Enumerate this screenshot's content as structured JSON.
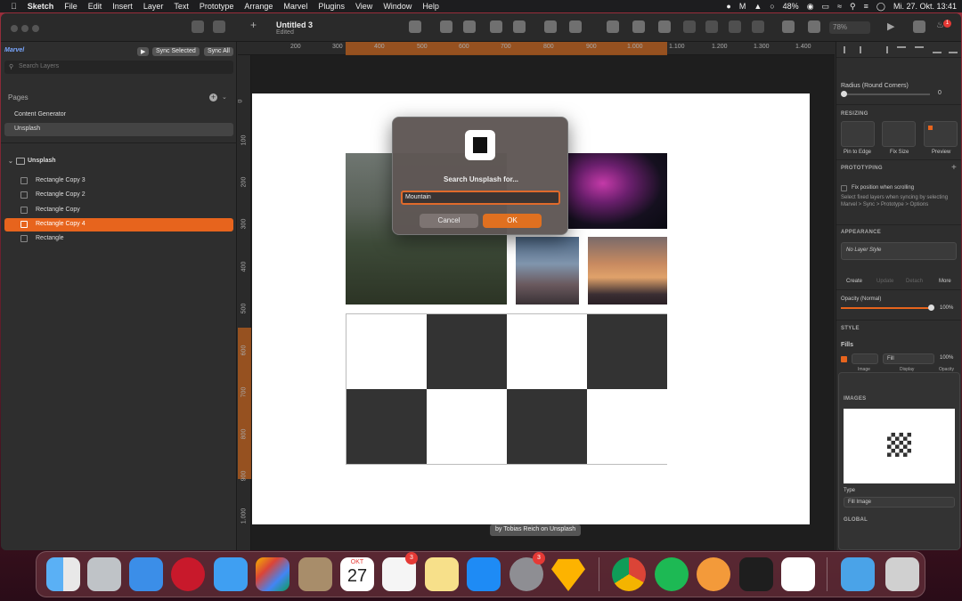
{
  "menubar": {
    "app": "Sketch",
    "items": [
      "File",
      "Edit",
      "Insert",
      "Layer",
      "Text",
      "Prototype",
      "Arrange",
      "Marvel",
      "Plugins",
      "View",
      "Window",
      "Help"
    ],
    "battery": "48%",
    "clock": "Mi. 27. Okt.  13:41",
    "notification_badge": "1"
  },
  "toolbar": {
    "doc_title": "Untitled 3",
    "doc_status": "Edited",
    "zoom": "78%"
  },
  "sidebar": {
    "marvel_logo": "Marvel",
    "sync_selected": "Sync Selected",
    "sync_all": "Sync All",
    "search_placeholder": "Search Layers",
    "pages_label": "Pages",
    "pages": [
      "Content Generator",
      "Unsplash"
    ],
    "artboard": "Unsplash",
    "layers": [
      "Rectangle Copy 3",
      "Rectangle Copy 2",
      "Rectangle Copy",
      "Rectangle Copy 4",
      "Rectangle"
    ]
  },
  "rulers": {
    "top": [
      "200",
      "300",
      "400",
      "500",
      "600",
      "700",
      "800",
      "900",
      "1.000",
      "1.100",
      "1.200",
      "1.300",
      "1.400"
    ],
    "left": [
      "0",
      "100",
      "200",
      "300",
      "400",
      "500",
      "600",
      "700",
      "800",
      "900",
      "1.000"
    ]
  },
  "dialog": {
    "title": "Search Unsplash for...",
    "input_value": "Mountain",
    "cancel": "Cancel",
    "ok": "OK"
  },
  "attribution": "by Tobias Reich on Unsplash",
  "inspector": {
    "radius_label": "Radius (Round Corners)",
    "radius_value": "0",
    "resizing": "RESIZING",
    "pin_to_edge": "Pin to Edge",
    "fix_size": "Fix Size",
    "preview": "Preview",
    "prototyping": "PROTOTYPING",
    "fix_position": "Fix position when scrolling",
    "fix_position_help": "Select fixed layers when syncing by selecting Marvel > Sync > Prototype > Options",
    "appearance": "APPEARANCE",
    "layer_style": "No Layer Style",
    "create": "Create",
    "update": "Update",
    "detach": "Detach",
    "more": "More",
    "opacity_label": "Opacity (Normal)",
    "opacity_value": "100%",
    "style": "STYLE",
    "fills": "Fills",
    "fill_type": "Fill",
    "fill_opacity": "100%",
    "image_label": "Image",
    "display_label": "Display",
    "opacity_col": "Opacity",
    "images": "IMAGES",
    "type_label": "Type",
    "type_value": "Fill Image",
    "global": "GLOBAL"
  },
  "dock": {
    "calendar_month": "OKT",
    "calendar_day": "27",
    "reminders_badge": "3",
    "settings_badge": "3"
  }
}
